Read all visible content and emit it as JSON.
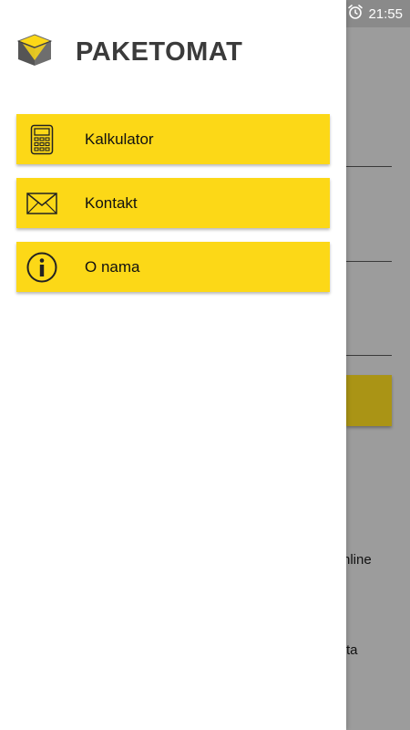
{
  "status_bar": {
    "time": "21:55",
    "alarm_icon": "alarm-clock-icon"
  },
  "app": {
    "title": "PAKETOMAT",
    "logo_icon": "package-box-icon"
  },
  "menu": {
    "items": [
      {
        "label": "Kalkulator",
        "icon": "calculator-icon"
      },
      {
        "label": "Kontakt",
        "icon": "envelope-icon"
      },
      {
        "label": "O nama",
        "icon": "info-icon"
      }
    ]
  },
  "background_screen": {
    "text_1": "nline",
    "text_2": "ta"
  },
  "colors": {
    "accent": "#fcd817",
    "title": "#3b3b3b",
    "status_bar": "#8a8a8a",
    "scrim": "#9c9c9c"
  }
}
